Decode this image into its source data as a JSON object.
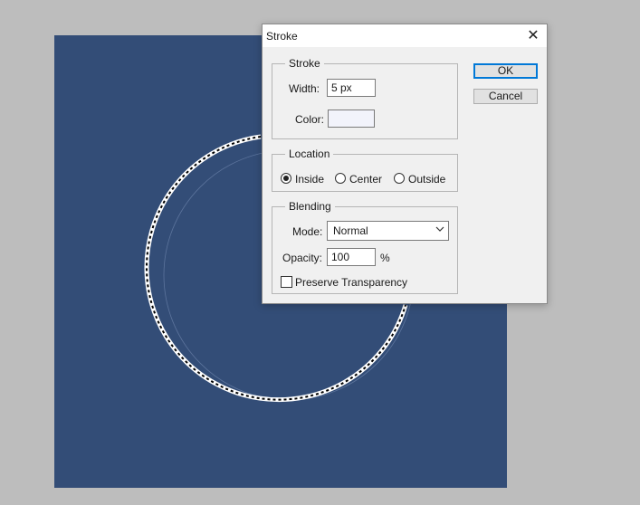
{
  "dialog": {
    "title": "Stroke",
    "close_glyph": "✕",
    "stroke_group": {
      "legend": "Stroke",
      "width_label": "Width:",
      "width_value": "5 px",
      "color_label": "Color:",
      "color_value": "#f2f3fb"
    },
    "location_group": {
      "legend": "Location",
      "options": [
        {
          "label": "Inside",
          "checked": true
        },
        {
          "label": "Center",
          "checked": false
        },
        {
          "label": "Outside",
          "checked": false
        }
      ]
    },
    "blending_group": {
      "legend": "Blending",
      "mode_label": "Mode:",
      "mode_value": "Normal",
      "opacity_label": "Opacity:",
      "opacity_value": "100",
      "opacity_unit": "%",
      "preserve_label": "Preserve Transparency",
      "preserve_checked": false
    },
    "buttons": {
      "ok": "OK",
      "cancel": "Cancel"
    }
  },
  "canvas": {
    "background": "#334d77"
  },
  "icons": {
    "close": "close-icon",
    "dropdown": "chevron-down-icon"
  }
}
